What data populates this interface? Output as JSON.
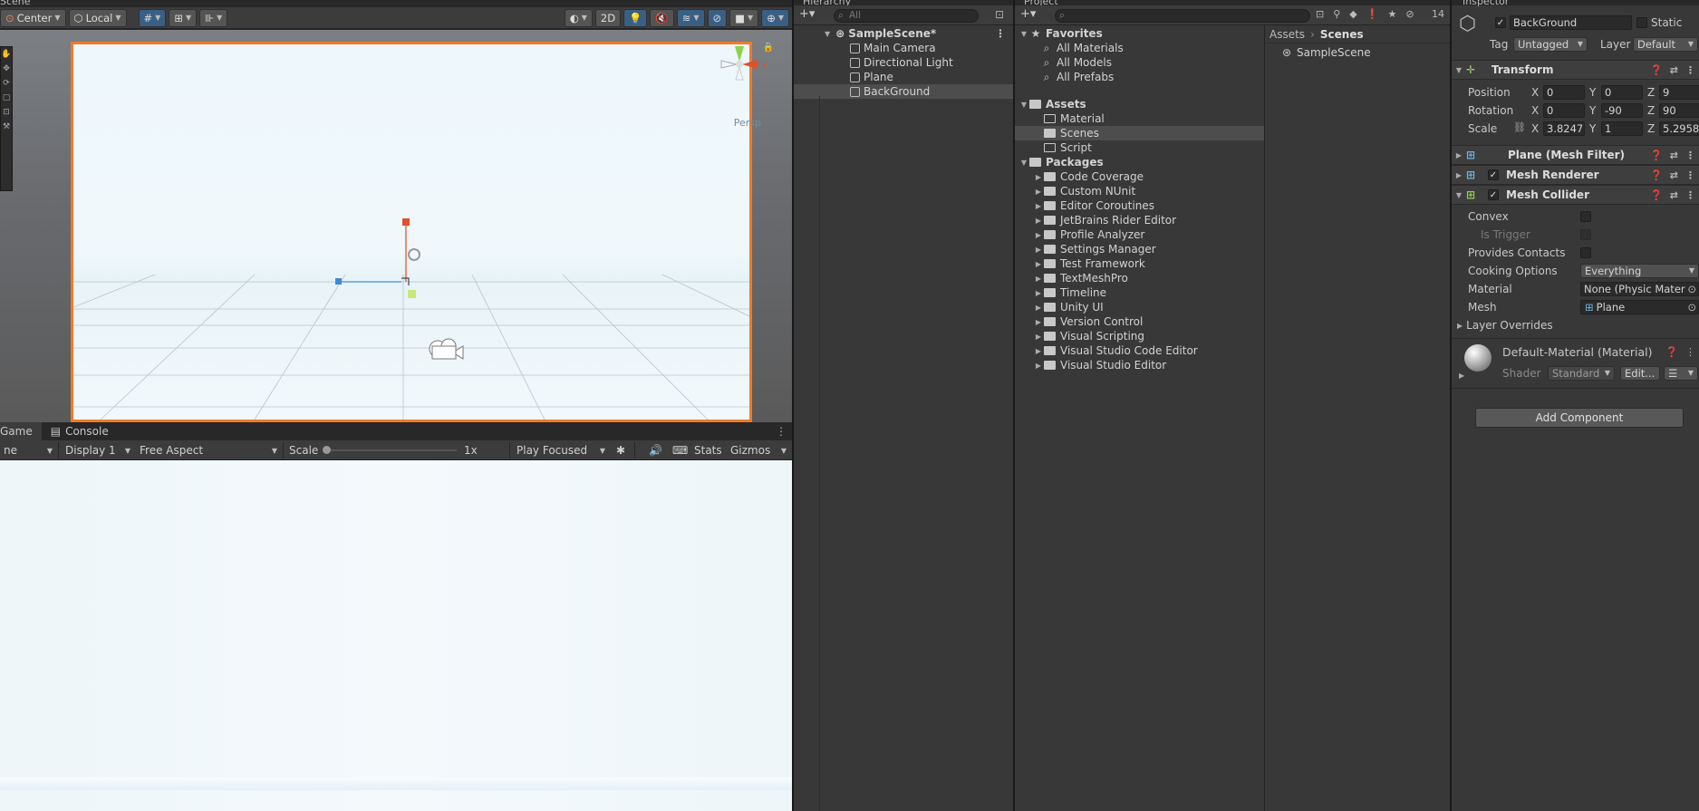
{
  "scene": {
    "tab": "Scene",
    "toolbar": {
      "pivot": "Center",
      "space": "Local",
      "mode_2d": "2D"
    },
    "persp_label": "Persp",
    "axis_x": "x"
  },
  "game": {
    "tabs": [
      "Game",
      "Console"
    ],
    "display_mode": "ne",
    "display": "Display 1",
    "aspect": "Free Aspect",
    "scale_label": "Scale",
    "scale_value": "1x",
    "play_mode": "Play Focused",
    "stats": "Stats",
    "gizmos": "Gizmos"
  },
  "hierarchy": {
    "tab": "Hierarchy",
    "search_placeholder": "All",
    "scene": "SampleScene*",
    "items": [
      "Main Camera",
      "Directional Light",
      "Plane",
      "BackGround"
    ]
  },
  "project": {
    "tab": "Project",
    "hidden_count": "14",
    "favorites": {
      "label": "Favorites",
      "items": [
        "All Materials",
        "All Models",
        "All Prefabs"
      ]
    },
    "assets": {
      "label": "Assets",
      "items": [
        "Material",
        "Scenes",
        "Script"
      ]
    },
    "packages": {
      "label": "Packages",
      "items": [
        "Code Coverage",
        "Custom NUnit",
        "Editor Coroutines",
        "JetBrains Rider Editor",
        "Profile Analyzer",
        "Settings Manager",
        "Test Framework",
        "TextMeshPro",
        "Timeline",
        "Unity UI",
        "Version Control",
        "Visual Scripting",
        "Visual Studio Code Editor",
        "Visual Studio Editor"
      ]
    },
    "breadcrumb": [
      "Assets",
      "Scenes"
    ],
    "files": [
      "SampleScene"
    ]
  },
  "inspector": {
    "tab": "Inspector",
    "object_name": "BackGround",
    "static_label": "Static",
    "tag_label": "Tag",
    "tag_value": "Untagged",
    "layer_label": "Layer",
    "layer_value": "Default",
    "transform": {
      "title": "Transform",
      "position_label": "Position",
      "rotation_label": "Rotation",
      "scale_label": "Scale",
      "position": {
        "x": "0",
        "y": "0",
        "z": "9"
      },
      "rotation": {
        "x": "0",
        "y": "-90",
        "z": "90"
      },
      "scale": {
        "x": "3.8247",
        "y": "1",
        "z": "5.2958"
      }
    },
    "mesh_filter": "Plane (Mesh Filter)",
    "mesh_renderer": "Mesh Renderer",
    "mesh_collider": {
      "title": "Mesh Collider",
      "convex": "Convex",
      "is_trigger": "Is Trigger",
      "provides_contacts": "Provides Contacts",
      "cooking_label": "Cooking Options",
      "cooking_value": "Everything",
      "material_label": "Material",
      "material_value": "None (Physic Mater",
      "mesh_label": "Mesh",
      "mesh_value": "Plane",
      "layer_overrides": "Layer Overrides"
    },
    "material": {
      "title": "Default-Material (Material)",
      "shader_label": "Shader",
      "shader_value": "Standard",
      "edit": "Edit..."
    },
    "add_component": "Add Component"
  }
}
